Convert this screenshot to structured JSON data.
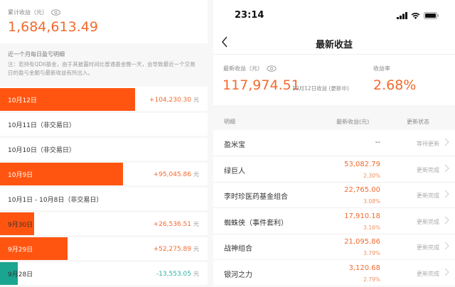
{
  "left": {
    "cumulative_label": "累计收益（元）",
    "cumulative_value": "1,684,613.49",
    "note_title": "近一个月每日盈亏明细",
    "note_text": "注：若持有QDII基金，由于其披露时间比普通基金晚一天，会导致最近一个交易日的盈亏金额与最新收益有所出入。",
    "unit": "元",
    "rows": [
      {
        "date": "10月12日",
        "value": "+104,230.30",
        "amount": 104230.3
      },
      {
        "date": "10月11日（非交易日）",
        "value": null,
        "amount": 0
      },
      {
        "date": "10月10日（非交易日）",
        "value": null,
        "amount": 0
      },
      {
        "date": "10月9日",
        "value": "+95,045.86",
        "amount": 95045.86
      },
      {
        "date": "10月1日 - 10月8日（非交易日）",
        "value": null,
        "amount": 0
      },
      {
        "date": "9月30日",
        "value": "+26,536.51",
        "amount": 26536.51
      },
      {
        "date": "9月29日",
        "value": "+52,275.89",
        "amount": 52275.89
      },
      {
        "date": "9月28日",
        "value": "-13,553.05",
        "amount": -13553.05
      }
    ],
    "colors": {
      "gain": "#ff5511",
      "loss": "#1aa590",
      "gain_text": "#f26a2e",
      "loss_text": "#2ab0a0"
    }
  },
  "right": {
    "time": "23:14",
    "title": "最新收益",
    "latest_label": "最新收益（元）",
    "latest_value": "117,974.51",
    "latest_date": "10月12日收益 (更新中)",
    "rate_label": "收益率",
    "rate_value": "2.68%",
    "headers": {
      "detail": "明细",
      "amount": "最新收益(元)",
      "status": "更新状态"
    },
    "items": [
      {
        "name": "盈米宝",
        "amount": "--",
        "pct": "",
        "status": "等待更新"
      },
      {
        "name": "绿巨人",
        "amount": "53,082.79",
        "pct": "2.30%",
        "status": "更新完成"
      },
      {
        "name": "李时珍医药基金组合",
        "amount": "22,765.00",
        "pct": "3.08%",
        "status": "更新完成"
      },
      {
        "name": "蜘蛛侠（事件套利）",
        "amount": "17,910.18",
        "pct": "3.16%",
        "status": "更新完成"
      },
      {
        "name": "战神组合",
        "amount": "21,095.86",
        "pct": "3.79%",
        "status": "更新完成"
      },
      {
        "name": "银河之力",
        "amount": "3,120.68",
        "pct": "2.79%",
        "status": "更新完成"
      }
    ]
  }
}
